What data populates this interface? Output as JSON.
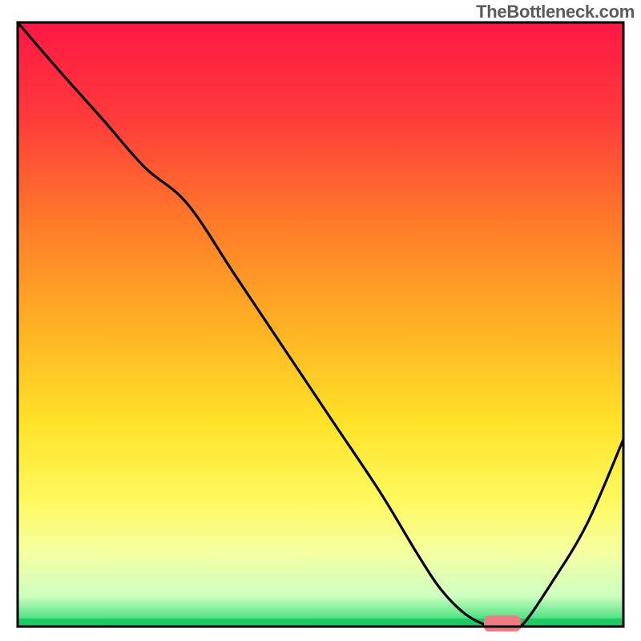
{
  "watermark": "TheBottleneck.com",
  "chart_data": {
    "type": "line",
    "title": "",
    "xlabel": "",
    "ylabel": "",
    "xlim": [
      0,
      100
    ],
    "ylim": [
      0,
      100
    ],
    "background_gradient": {
      "stops": [
        {
          "offset": 0.0,
          "color": "#ff1744"
        },
        {
          "offset": 0.16,
          "color": "#ff3b3b"
        },
        {
          "offset": 0.33,
          "color": "#ff7a29"
        },
        {
          "offset": 0.5,
          "color": "#ffb024"
        },
        {
          "offset": 0.66,
          "color": "#ffe228"
        },
        {
          "offset": 0.79,
          "color": "#fff95e"
        },
        {
          "offset": 0.88,
          "color": "#f4ffa3"
        },
        {
          "offset": 0.95,
          "color": "#cdffc1"
        },
        {
          "offset": 1.0,
          "color": "#22d66a"
        }
      ]
    },
    "series": [
      {
        "name": "bottleneck-curve",
        "color": "#000000",
        "x": [
          0,
          6,
          14,
          21,
          28,
          36,
          44,
          52,
          60,
          66,
          70,
          74,
          78,
          80,
          83,
          88,
          94,
          100
        ],
        "y": [
          100,
          93,
          84,
          76,
          70,
          58,
          46,
          34,
          22,
          12,
          6,
          2,
          0,
          0,
          0,
          7,
          17,
          31
        ]
      }
    ],
    "marker": {
      "name": "optimal-range",
      "color": "#ef7b83",
      "x_start": 77,
      "x_end": 83,
      "y": 0.5,
      "thickness": 1.6
    },
    "axes_visible": false,
    "grid": false
  }
}
